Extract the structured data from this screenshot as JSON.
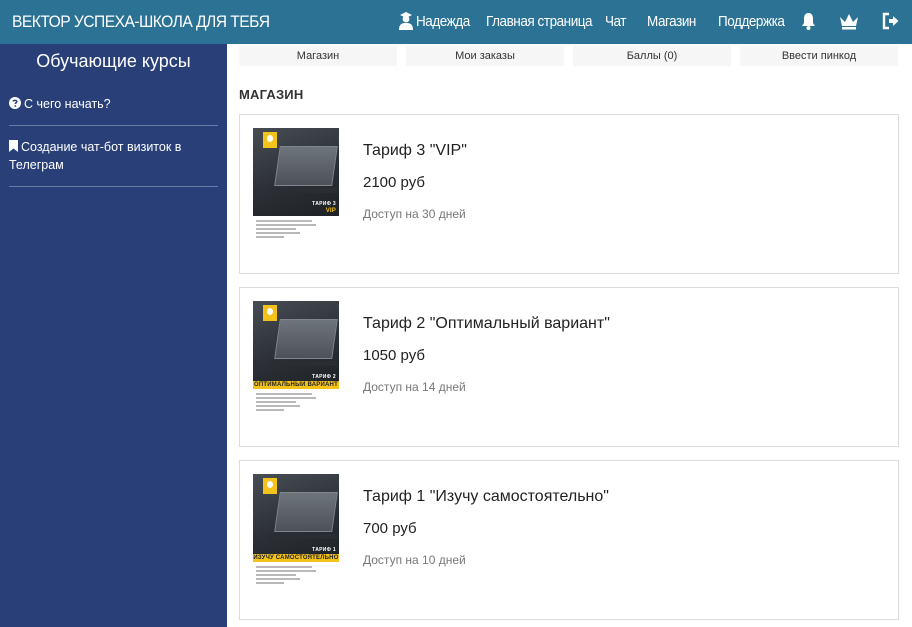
{
  "header": {
    "brand": "ВЕКТОР УСПЕХА-ШКОЛА ДЛЯ ТЕБЯ",
    "user_name": "Надежда",
    "nav": [
      "Главная страница",
      "Чат",
      "Магазин",
      "Поддержка"
    ],
    "icons": [
      "user-graduate-icon",
      "bell-icon",
      "crown-icon",
      "sign-out-icon"
    ],
    "color": "#2b7294"
  },
  "sidebar": {
    "title": "Обучающие курсы",
    "items": [
      {
        "label": "С чего начать?",
        "icon": "question-circle-icon"
      },
      {
        "label": "Создание чат-бот визиток в Телеграм",
        "icon": "bookmark-icon"
      }
    ],
    "color": "#293f78"
  },
  "tabs": [
    "Магазин",
    "Мои заказы",
    "Баллы (0)",
    "Ввести пинкод"
  ],
  "section_title": "МАГАЗИН",
  "products": [
    {
      "title": "Тариф 3 \"VIP\"",
      "price": "2100 руб",
      "access": "Доступ на 30 дней",
      "thumb_label": "ТАРИФ 3",
      "thumb_sub": "VIP"
    },
    {
      "title": "Тариф 2 \"Оптимальный вариант\"",
      "price": "1050 руб",
      "access": "Доступ на 14 дней",
      "thumb_label": "ТАРИФ 2",
      "thumb_sub": "ОПТИМАЛЬНЫЙ ВАРИАНТ"
    },
    {
      "title": "Тариф 1 \"Изучу самостоятельно\"",
      "price": "700 руб",
      "access": "Доступ на 10 дней",
      "thumb_label": "ТАРИФ 1",
      "thumb_sub": "ИЗУЧУ САМОСТОЯТЕЛЬНО"
    }
  ]
}
